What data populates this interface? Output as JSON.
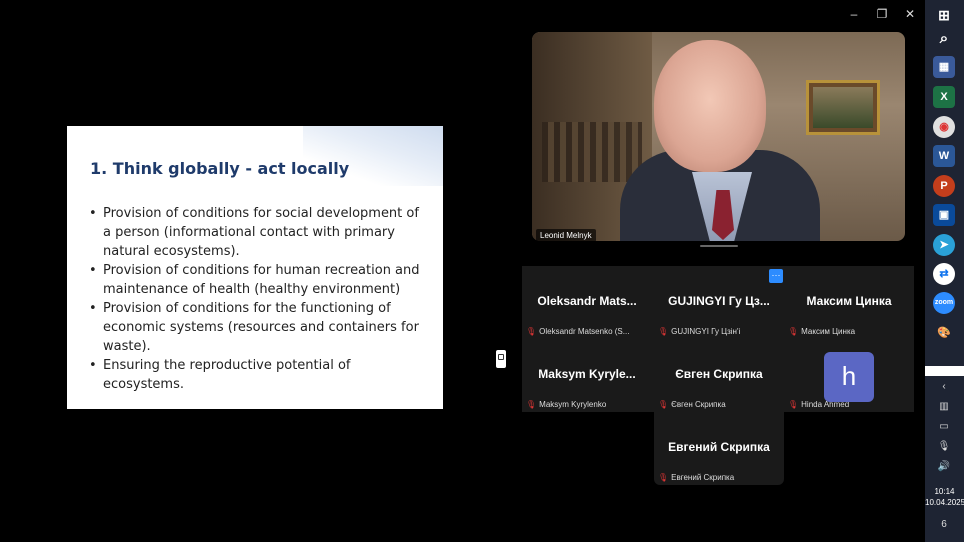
{
  "window": {
    "minimize_glyph": "–",
    "restore_glyph": "❐",
    "close_glyph": "✕"
  },
  "slide": {
    "title": "1. Think globally - act locally",
    "bullets": [
      "Provision of conditions for social development of a person (informational contact with primary natural ecosystems).",
      "Provision of conditions for human recreation and maintenance of health (healthy environment)",
      "Provision of conditions for the functioning of economic systems (resources and containers for waste).",
      "Ensuring the reproductive potential of ecosystems."
    ]
  },
  "speaker": {
    "name": "Leonid Melnyk"
  },
  "gallery": {
    "more_glyph": "···",
    "tiles": [
      {
        "display": "Oleksandr  Mats...",
        "label": "Oleksandr Matsenko (S..."
      },
      {
        "display": "GUJINGYI Гу Цз...",
        "label": "GUJINGYI Гу Цзін'і"
      },
      {
        "display": "Максим Цинка",
        "label": "Максим Цинка"
      },
      {
        "display": "Maksym  Kyryle...",
        "label": "Maksym Kyrylenko"
      },
      {
        "display": "Євген Скрипка",
        "label": "Євген Скрипка"
      },
      {
        "display": "h",
        "label": "Hinda Ahmed"
      },
      {
        "display": "Евгений Скрипка",
        "label": "Евгений Скрипка"
      }
    ]
  },
  "taskbar": {
    "time": "10:14",
    "date": "10.04.2025",
    "notification_count": "6"
  },
  "colors": {
    "slide_title": "#1f3b6b",
    "gallery_bg": "#1a1a1a",
    "muted_mic": "#e03535",
    "avatar_bg": "#5b67c4",
    "accent": "#2d8cff",
    "taskbar_bg": "#1e2433"
  }
}
